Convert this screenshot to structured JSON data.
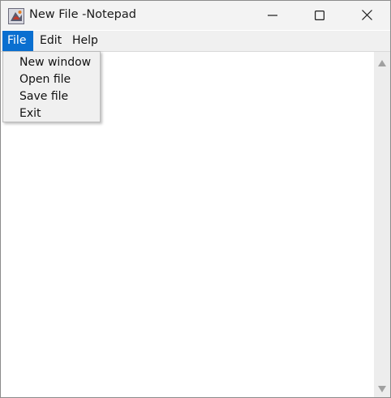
{
  "window": {
    "title": "New File -Notepad"
  },
  "menubar": {
    "items": [
      {
        "label": "File"
      },
      {
        "label": "Edit"
      },
      {
        "label": "Help"
      }
    ]
  },
  "file_menu": {
    "items": [
      {
        "label": "New window"
      },
      {
        "label": "Open file"
      },
      {
        "label": "Save file"
      },
      {
        "label": "Exit"
      }
    ]
  },
  "editor": {
    "content": ""
  },
  "icons": {
    "app": "notepad-java-app-icon",
    "minimize": "minimize-icon",
    "maximize": "maximize-icon",
    "close": "close-icon",
    "scroll_up": "scroll-up-arrow-icon",
    "scroll_down": "scroll-down-arrow-icon"
  },
  "colors": {
    "menu_selected_bg": "#0a6fd0",
    "menu_selected_text": "#ffffff",
    "menubar_bg": "#f0f0f0",
    "titlebar_bg": "#f3f3f3"
  }
}
